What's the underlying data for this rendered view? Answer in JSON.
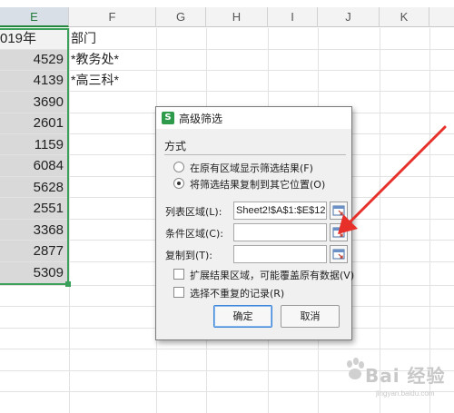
{
  "columns": [
    "E",
    "F",
    "G",
    "H",
    "I",
    "J",
    "K"
  ],
  "active_column": "E",
  "column_e": {
    "header": "019年",
    "values": [
      "4529",
      "4139",
      "3690",
      "2601",
      "1159",
      "6084",
      "5628",
      "2551",
      "3368",
      "2877",
      "5309"
    ]
  },
  "column_f": {
    "header": "部门",
    "values": [
      "*教务处*",
      "*高三科*"
    ]
  },
  "dialog": {
    "app_icon": "S",
    "title": "高级筛选",
    "method_label": "方式",
    "radio_in_place": "在原有区域显示筛选结果(F)",
    "radio_copy": "将筛选结果复制到其它位置(O)",
    "list_range_label": "列表区域(L):",
    "list_range_value": "Sheet2!$A$1:$E$12",
    "criteria_range_label": "条件区域(C):",
    "criteria_range_value": "",
    "copy_to_label": "复制到(T):",
    "copy_to_value": "",
    "expand_label": "扩展结果区域，可能覆盖原有数据(V)",
    "unique_label": "选择不重复的记录(R)",
    "ok_label": "确定",
    "cancel_label": "取消",
    "selected_option": "copy"
  },
  "annotation_color": "#e8302a",
  "accent_green": "#3aa05a",
  "watermark": {
    "text": "Bai 经验",
    "sub": "jingyan.baidu.com"
  }
}
